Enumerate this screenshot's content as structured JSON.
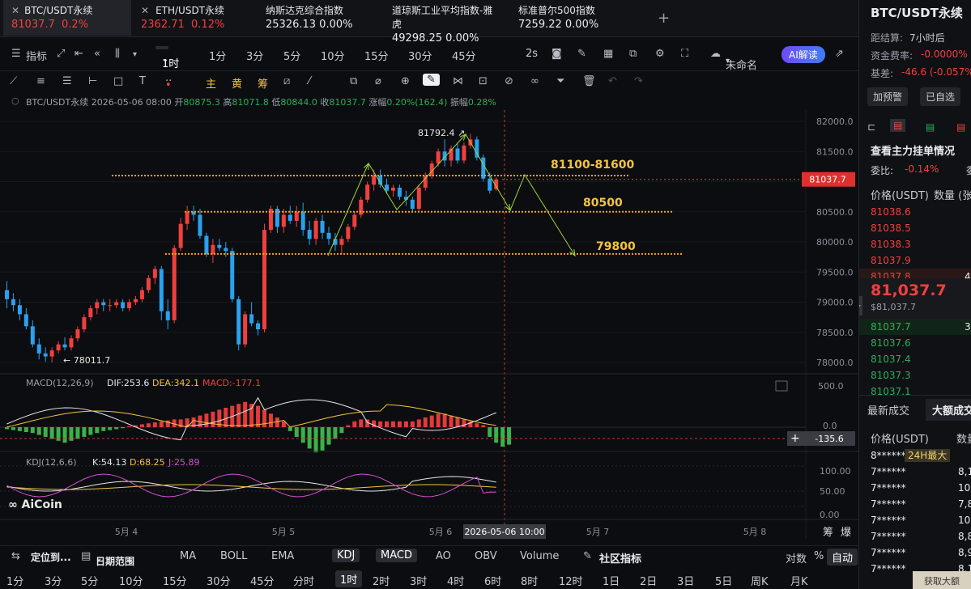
{
  "tickers": [
    {
      "name": "BTC/USDT永续",
      "price": "81037.7",
      "change": "0.2%",
      "dir": "up"
    },
    {
      "name": "ETH/USDT永续",
      "price": "2362.71",
      "change": "0.12%",
      "dir": "up"
    },
    {
      "name": "纳斯达克综合指数",
      "price": "25326.13",
      "change": "0.00%",
      "dir": "flat"
    },
    {
      "name": "道琼斯工业平均指数-雅虎",
      "price": "49298.25",
      "change": "0.00%",
      "dir": "flat"
    },
    {
      "name": "标准普尔500指数",
      "price": "7259.22",
      "change": "0.00%",
      "dir": "flat"
    }
  ],
  "add_tab": "+",
  "toolbar": {
    "indicators": "指标",
    "interval_selected": "1时",
    "intervals": [
      "1分",
      "3分",
      "5分",
      "10分",
      "15分",
      "30分",
      "45分"
    ],
    "interval_2s": "2s",
    "layout_name": "未命名",
    "ai_button": "AI解读"
  },
  "drawing_tools": {
    "main": "主",
    "chou": "筹",
    "huang": "黄"
  },
  "info": {
    "symbol": "BTC/USDT永续",
    "datetime": "2026-05-06 08:00",
    "open_label": "开",
    "open": "80875.3",
    "high_label": "高",
    "high": "81071.8",
    "low_label": "低",
    "low": "80844.0",
    "close_label": "收",
    "close": "81037.7",
    "chg_label": "涨幅",
    "chg": "0.20%(162.4)",
    "amp_label": "振幅",
    "amp": "0.28%"
  },
  "chart_data": {
    "type": "candlestick",
    "price_axis": [
      "82000.0",
      "81500.0",
      "81000.0",
      "80500.0",
      "80000.0",
      "79500.0",
      "79000.0",
      "78500.0",
      "78000.0"
    ],
    "last_price": "81037.7",
    "date_labels": [
      "5月 4",
      "5月 5",
      "5月 6",
      "5月 7",
      "5月 8"
    ],
    "crosshair_time": "2026-05-06 10:00",
    "high_annotation": "81792.4",
    "low_annotation": "78011.7",
    "zones": [
      {
        "label": "81100-81600",
        "price": 81100
      },
      {
        "label": "80500",
        "price": 80500
      },
      {
        "label": "79800",
        "price": 79800
      }
    ],
    "candles": [
      [
        79200,
        79350,
        78900,
        79050
      ],
      [
        79050,
        79150,
        78850,
        78950
      ],
      [
        78950,
        79050,
        78700,
        78800
      ],
      [
        78800,
        78900,
        78550,
        78600
      ],
      [
        78600,
        78700,
        78250,
        78300
      ],
      [
        78300,
        78400,
        78050,
        78150
      ],
      [
        78150,
        78250,
        78011.7,
        78100
      ],
      [
        78100,
        78250,
        78000,
        78200
      ],
      [
        78200,
        78350,
        78150,
        78300
      ],
      [
        78300,
        78420,
        78200,
        78250
      ],
      [
        78250,
        78450,
        78200,
        78400
      ],
      [
        78400,
        78600,
        78350,
        78550
      ],
      [
        78550,
        78800,
        78500,
        78750
      ],
      [
        78750,
        78950,
        78700,
        78900
      ],
      [
        78900,
        79050,
        78800,
        79000
      ],
      [
        79000,
        79050,
        78850,
        78950
      ],
      [
        78950,
        79050,
        78850,
        78950
      ],
      [
        78950,
        79050,
        78900,
        79000
      ],
      [
        79000,
        79050,
        78850,
        78900
      ],
      [
        78900,
        79050,
        78850,
        79000
      ],
      [
        79000,
        79100,
        78950,
        79050
      ],
      [
        79050,
        79250,
        79000,
        79200
      ],
      [
        79200,
        79450,
        79150,
        79400
      ],
      [
        79400,
        79600,
        79300,
        79550
      ],
      [
        79550,
        79600,
        78700,
        78850
      ],
      [
        78850,
        79050,
        78550,
        78700
      ],
      [
        78700,
        79950,
        78650,
        79900
      ],
      [
        79900,
        80400,
        79850,
        80300
      ],
      [
        80300,
        80600,
        80200,
        80500
      ],
      [
        80500,
        80600,
        80350,
        80450
      ],
      [
        80450,
        80550,
        80050,
        80100
      ],
      [
        80100,
        80150,
        79750,
        79800
      ],
      [
        79800,
        80050,
        79650,
        79950
      ],
      [
        79950,
        80050,
        79850,
        79900
      ],
      [
        79900,
        80000,
        79750,
        79850
      ],
      [
        79850,
        79900,
        79000,
        79050
      ],
      [
        79050,
        79100,
        78200,
        78300
      ],
      [
        78300,
        78850,
        78250,
        78800
      ],
      [
        78800,
        79000,
        78600,
        78650
      ],
      [
        78650,
        78700,
        78450,
        78550
      ],
      [
        78550,
        80300,
        78500,
        80200
      ],
      [
        80200,
        80600,
        80150,
        80550
      ],
      [
        80550,
        80600,
        80150,
        80250
      ],
      [
        80250,
        80550,
        80150,
        80450
      ],
      [
        80450,
        80600,
        80300,
        80350
      ],
      [
        80350,
        80600,
        80250,
        80500
      ],
      [
        80500,
        80650,
        80100,
        80200
      ],
      [
        80200,
        80350,
        79950,
        80050
      ],
      [
        80050,
        80400,
        79950,
        80350
      ],
      [
        80350,
        80450,
        80050,
        80150
      ],
      [
        80150,
        80250,
        79950,
        80050
      ],
      [
        80050,
        80150,
        79850,
        79950
      ],
      [
        79950,
        80100,
        79800,
        80050
      ],
      [
        80050,
        80300,
        80000,
        80250
      ],
      [
        80250,
        80500,
        80200,
        80450
      ],
      [
        80450,
        80750,
        80400,
        80700
      ],
      [
        80700,
        81000,
        80650,
        80950
      ],
      [
        80950,
        81200,
        80850,
        81100
      ],
      [
        81100,
        81200,
        80900,
        80950
      ],
      [
        80950,
        81050,
        80800,
        80850
      ],
      [
        80850,
        80950,
        80750,
        80900
      ],
      [
        80900,
        80950,
        80700,
        80750
      ],
      [
        80750,
        80850,
        80600,
        80700
      ],
      [
        80700,
        80750,
        80500,
        80550
      ],
      [
        80550,
        80950,
        80500,
        80900
      ],
      [
        80900,
        81150,
        80850,
        81100
      ],
      [
        81100,
        81350,
        81050,
        81300
      ],
      [
        81300,
        81550,
        81250,
        81500
      ],
      [
        81500,
        81700,
        81250,
        81350
      ],
      [
        81350,
        81600,
        81250,
        81550
      ],
      [
        81550,
        81650,
        81300,
        81350
      ],
      [
        81350,
        81650,
        81300,
        81600
      ],
      [
        81600,
        81792.4,
        81550,
        81700
      ],
      [
        81700,
        81750,
        81350,
        81400
      ],
      [
        81400,
        81450,
        81000,
        81050
      ],
      [
        81050,
        81150,
        80800,
        80850
      ],
      [
        80875.3,
        81071.8,
        80844.0,
        81037.7
      ]
    ],
    "macd": {
      "label": "MACD(12,26,9)",
      "dif": "DIF:253.6",
      "dea": "DEA:342.1",
      "macd": "MACD:-177.1",
      "axis": [
        "500.0",
        "0.0"
      ],
      "cursor": "-135.6"
    },
    "kdj": {
      "label": "KDJ(12,6,6)",
      "k": "K:54.13",
      "d": "D:68.25",
      "j": "J:25.89",
      "axis": [
        "100.00",
        "50.00",
        "0.00"
      ]
    },
    "colors": {
      "up": "#f0403e",
      "down": "#2aa1f0",
      "zone": "#f4a21e",
      "arrow": "#9bd33a"
    }
  },
  "bottom": {
    "locate": "定位到...",
    "range": "日期范围",
    "indicators": [
      "MA",
      "BOLL",
      "EMA"
    ],
    "sub_indicators": [
      "KDJ",
      "MACD",
      "AO",
      "OBV",
      "Volume"
    ],
    "community": "社区指标",
    "log": "对数",
    "pct": "%",
    "auto": "自动",
    "intervals": [
      "1分",
      "3分",
      "5分",
      "10分",
      "15分",
      "30分",
      "45分",
      "分时",
      "1时",
      "2时",
      "3时",
      "4时",
      "6时",
      "8时",
      "12时",
      "1日",
      "2日",
      "3日",
      "5日",
      "周K",
      "月K"
    ]
  },
  "watermark": "AiCoin",
  "corner_labels": {
    "chou": "筹",
    "bao": "爆"
  },
  "right": {
    "title": "BTC/USDT永续",
    "settle_label": "距结算:",
    "settle": "7小时后",
    "fund_label": "资金费率:",
    "fund": "-0.0000%",
    "basis_label": "基差:",
    "basis": "-46.6 (-0.057%)",
    "alert": "加预警",
    "fav": "已自选",
    "orderbook_title": "查看主力挂单情况",
    "ratio_label": "委比:",
    "ratio": "-0.14%",
    "ratio_tail": "委",
    "price_hdr": "价格(USDT)",
    "qty_hdr": "数量 (张",
    "asks": [
      {
        "p": "81038.6"
      },
      {
        "p": "81038.5"
      },
      {
        "p": "81038.3"
      },
      {
        "p": "81037.9"
      },
      {
        "p": "81037.8",
        "q": "4"
      }
    ],
    "mid": "81,037.7",
    "mid_sub": "$81,037.7",
    "bids": [
      {
        "p": "81037.7",
        "q": "3"
      },
      {
        "p": "81037.6"
      },
      {
        "p": "81037.4"
      },
      {
        "p": "81037.3"
      },
      {
        "p": "81037.1"
      }
    ],
    "trades_tab": "最新成交",
    "big_tab": "大额成交",
    "trades_price_hdr": "价格(USDT)",
    "trades_qty_hdr": "数量",
    "badge": "24H最大",
    "trades": [
      {
        "p": "8******",
        "q": ""
      },
      {
        "p": "7******",
        "q": "8,1"
      },
      {
        "p": "7******",
        "q": "10,0"
      },
      {
        "p": "7******",
        "q": "7,8"
      },
      {
        "p": "7******",
        "q": "10,6"
      },
      {
        "p": "7******",
        "q": "8,8"
      },
      {
        "p": "7******",
        "q": "8,9"
      },
      {
        "p": "7******",
        "q": "8,1"
      }
    ],
    "big_button": "获取大额"
  }
}
